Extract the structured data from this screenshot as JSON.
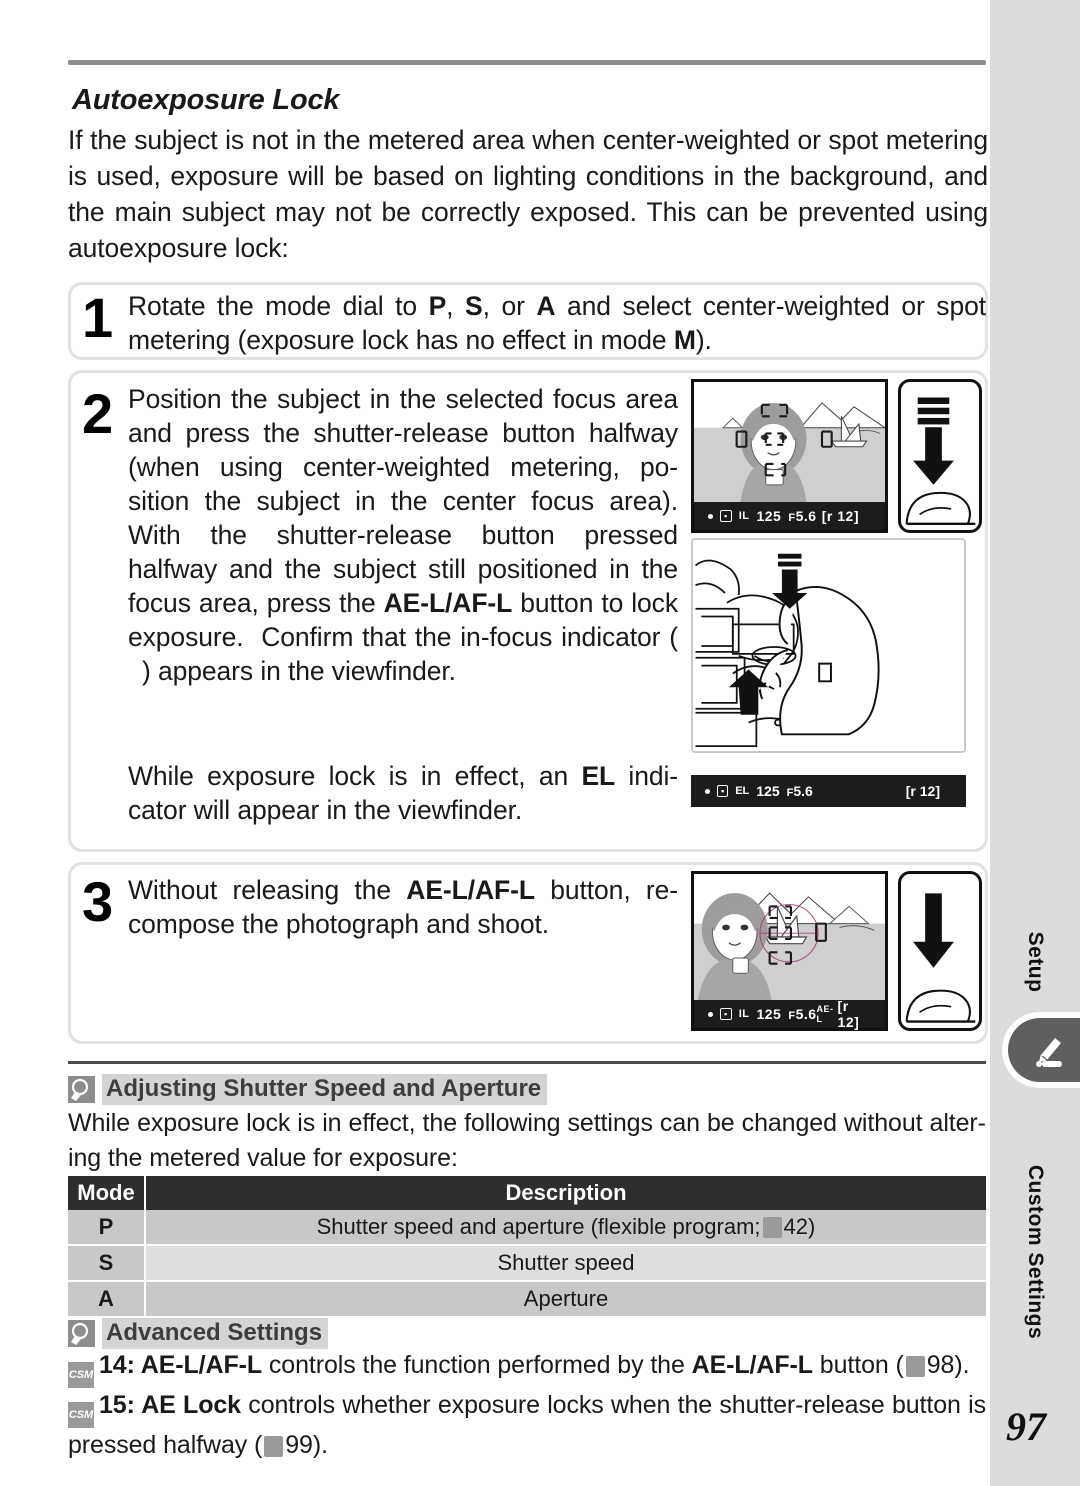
{
  "page": {
    "number": "97",
    "section_title": "Autoexposure Lock",
    "intro": "If the subject is not in the metered area when center-weighted or spot metering is used, exposure will be based on lighting conditions in the back­ground, and the main subject may not be correctly exposed.  This can be prevented using autoexposure lock:"
  },
  "steps": [
    {
      "number": "1",
      "text_parts": [
        "Rotate the mode dial to ",
        "P",
        ", ",
        "S",
        ", or ",
        "A",
        " and select center-weighted or spot metering (exposure lock has no effect in mode ",
        "M",
        ")."
      ],
      "text": "Rotate the mode dial to P, S, or A and select center-weighted or spot metering (exposure lock has no effect in mode M)."
    },
    {
      "number": "2",
      "text": "Position the subject in the selected focus area and press the shutter-release button halfway (when using center-weighted metering, po­sition the subject in the center focus area). With the shutter-release button pressed halfway and the subject still positioned in the focus area, press the AE-L/AF-L button to lock exposure.  Confirm that the in-focus indicator ( ) appears in the viewfinder.",
      "text2": "While exposure lock is in effect, an EL indi­cator will appear in the viewfinder."
    },
    {
      "number": "3",
      "text": "Without releasing the AE-L/AF-L button, re­compose the photograph and shoot."
    }
  ],
  "lcd": {
    "viewfinder_step2": {
      "flash": "●",
      "meter": "▫",
      "mode": "IL",
      "shutter": "125",
      "aperture_prefix": "F",
      "aperture": "5.6",
      "frames": "[r 12]"
    },
    "camera_top_step2": {
      "flash": "●",
      "meter": "▫",
      "mode": "EL",
      "shutter": "125",
      "aperture_prefix": "F",
      "aperture": "5.6",
      "frames": "[r 12]"
    },
    "viewfinder_step3": {
      "flash": "●",
      "meter": "▫",
      "mode": "IL",
      "shutter": "125",
      "aperture_prefix": "F",
      "aperture": "5.6",
      "extra": "AE-L",
      "frames": "[r 12]"
    }
  },
  "tip_shutter": {
    "icon": "magnifier-icon",
    "title": "Adjusting Shutter Speed and Aperture",
    "body": "While exposure lock is in effect, the following settings can be changed without alter­ing the metered value for exposure:"
  },
  "table": {
    "headers": [
      "Mode",
      "Description"
    ],
    "rows": [
      {
        "mode": "P",
        "description": "Shutter speed and aperture (flexible program;",
        "ref": "42"
      },
      {
        "mode": "S",
        "description": "Shutter speed",
        "ref": ""
      },
      {
        "mode": "A",
        "description": "Aperture",
        "ref": ""
      }
    ]
  },
  "tip_advanced": {
    "icon": "magnifier-icon",
    "title": "Advanced Settings",
    "lines": [
      {
        "badge": "CSM",
        "num": "14: AE-L/AF-L",
        "rest": " controls the function performed by the ",
        "bold2": "AE-L/AF-L",
        "rest2": " button (",
        "ref": "98",
        "tail": ")."
      },
      {
        "badge": "CSM",
        "num": "15: AE Lock",
        "rest": " controls whether exposure locks when the shutter-release button is pressed halfway (",
        "ref": "99",
        "tail": ")."
      }
    ]
  },
  "sidebar": {
    "tabs": [
      "Setup",
      "Custom Settings"
    ],
    "active_tab_icon": "pencil-icon"
  }
}
